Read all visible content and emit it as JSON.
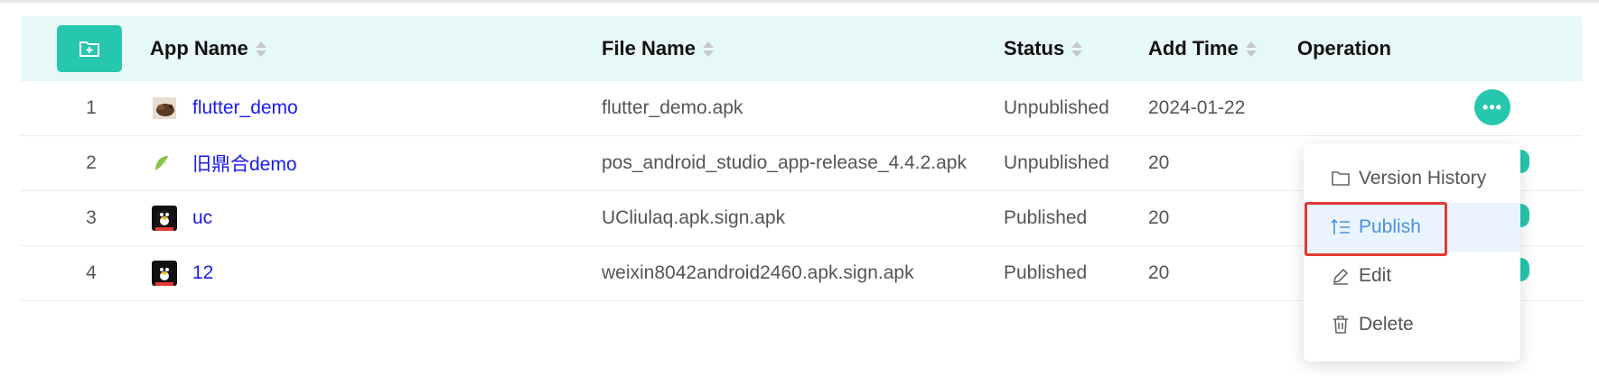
{
  "table": {
    "headers": {
      "app_name": "App Name",
      "file_name": "File Name",
      "status": "Status",
      "add_time": "Add Time",
      "operation": "Operation"
    },
    "rows": [
      {
        "index": "1",
        "app_name": "flutter_demo",
        "file_name": "flutter_demo.apk",
        "status": "Unpublished",
        "add_time": "2024-01-22",
        "icon": "flutter-app-icon"
      },
      {
        "index": "2",
        "app_name": "旧鼎合demo",
        "file_name": "pos_android_studio_app-release_4.4.2.apk",
        "status": "Unpublished",
        "add_time": "20",
        "icon": "android-app-icon"
      },
      {
        "index": "3",
        "app_name": "uc",
        "file_name": "UCliulaq.apk.sign.apk",
        "status": "Published",
        "add_time": "20",
        "icon": "qq-penguin-icon"
      },
      {
        "index": "4",
        "app_name": "12",
        "file_name": "weixin8042android2460.apk.sign.apk",
        "status": "Published",
        "add_time": "20",
        "icon": "qq-penguin-icon"
      }
    ]
  },
  "dropdown": {
    "items": [
      {
        "label": "Version History",
        "icon": "folder-icon"
      },
      {
        "label": "Publish",
        "icon": "publish-icon"
      },
      {
        "label": "Edit",
        "icon": "edit-pen-icon"
      },
      {
        "label": "Delete",
        "icon": "trash-icon"
      }
    ]
  },
  "colors": {
    "accent": "#26c7ad",
    "header_bg": "#e6f9f7",
    "link": "#1a1aee",
    "highlight": "#e53935",
    "active_item_bg": "#eaf4ff",
    "active_item_text": "#4a90d9"
  }
}
